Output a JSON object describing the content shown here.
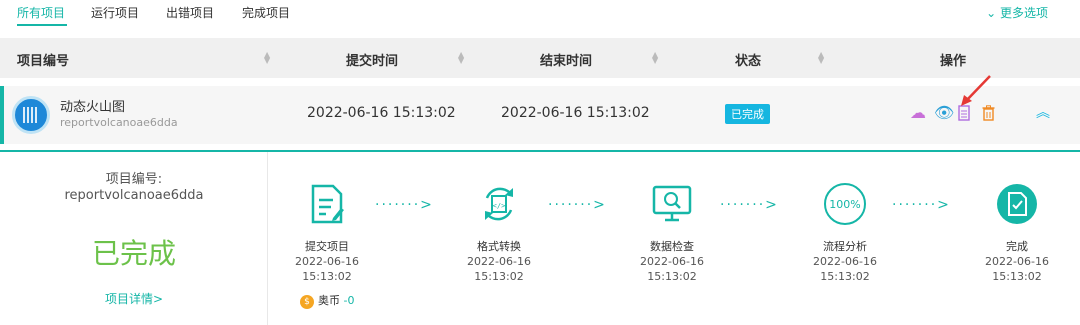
{
  "tabs": [
    "所有项目",
    "运行项目",
    "出错项目",
    "完成项目"
  ],
  "more_options": "更多选项",
  "table": {
    "headers": [
      "项目编号",
      "提交时间",
      "结束时间",
      "状态",
      "操作"
    ]
  },
  "row": {
    "name": "动态火山图",
    "id": "reportvolcanoae6dda",
    "submit_time": "2022-06-16 15:13:02",
    "end_time": "2022-06-16 15:13:02",
    "status": "已完成"
  },
  "detail": {
    "id_caption": "项目编号:",
    "id": "reportvolcanoae6dda",
    "status_big": "已完成",
    "detail_link": "项目详情>",
    "coin_label": "奥币",
    "coin_value": "-0",
    "steps": [
      {
        "label": "提交项目",
        "date": "2022-06-16",
        "time": "15:13:02"
      },
      {
        "label": "格式转换",
        "date": "2022-06-16",
        "time": "15:13:02"
      },
      {
        "label": "数据检查",
        "date": "2022-06-16",
        "time": "15:13:02"
      },
      {
        "label": "流程分析",
        "date": "2022-06-16",
        "time": "15:13:02",
        "icon_text": "100%"
      },
      {
        "label": "完成",
        "date": "2022-06-16",
        "time": "15:13:02"
      }
    ]
  },
  "colors": {
    "accent": "#15b6a7",
    "done_green": "#6cc24a",
    "badge": "#15b6e0"
  }
}
